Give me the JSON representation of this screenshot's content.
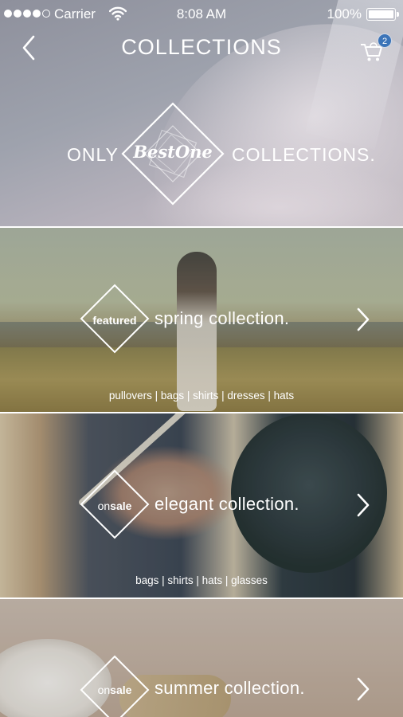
{
  "status_bar": {
    "carrier": "Carrier",
    "time": "8:08 AM",
    "battery": "100%",
    "signal_dots_filled": 4,
    "signal_dots_total": 5
  },
  "nav": {
    "title": "COLLECTIONS",
    "back_icon": "chevron-left-icon",
    "cart_icon": "cart-icon",
    "cart_count": "2",
    "badge_color": "#3b74b8"
  },
  "hero": {
    "tagline_left": "ONLY",
    "logo_text": "BestOne",
    "tagline_right": "COLLECTIONS."
  },
  "collections": [
    {
      "badge_bold": "featured",
      "badge_light": "",
      "title": "spring collection.",
      "tags": "pullovers | bags | shirts | dresses | hats"
    },
    {
      "badge_bold": "sale",
      "badge_light": "on",
      "title": "elegant collection.",
      "tags": "bags | shirts | hats | glasses"
    },
    {
      "badge_bold": "sale",
      "badge_light": "on",
      "title": "summer collection.",
      "tags": ""
    }
  ]
}
